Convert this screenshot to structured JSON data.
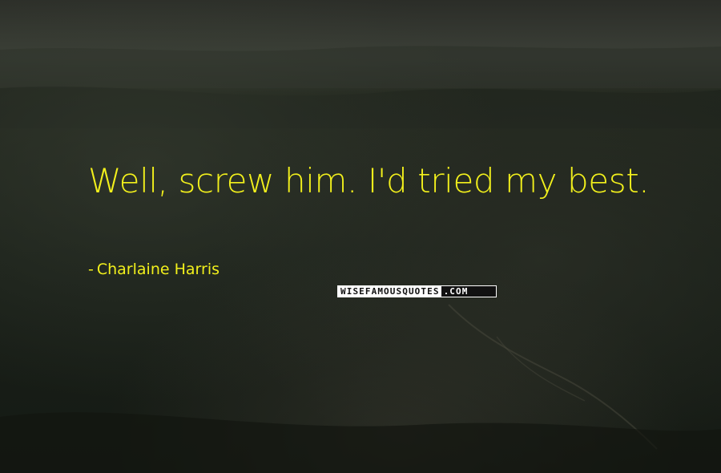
{
  "quote": {
    "text": "Well, screw him. I'd tried my best.",
    "author_dash": "-",
    "author": "Charlaine Harris"
  },
  "watermark": {
    "left_text": "WISEFAMOUSQUOTES",
    "right_text": ".COM"
  },
  "background": {
    "description_icon": "aerial-landscape-photo",
    "colors": {
      "sky_top": "#2a2c27",
      "horizon": "#3a3f37",
      "ground_dark": "#161b15",
      "ground_mid": "#242b22",
      "highlight": "#4a4a40"
    }
  },
  "accent_color": "#f2f01c"
}
